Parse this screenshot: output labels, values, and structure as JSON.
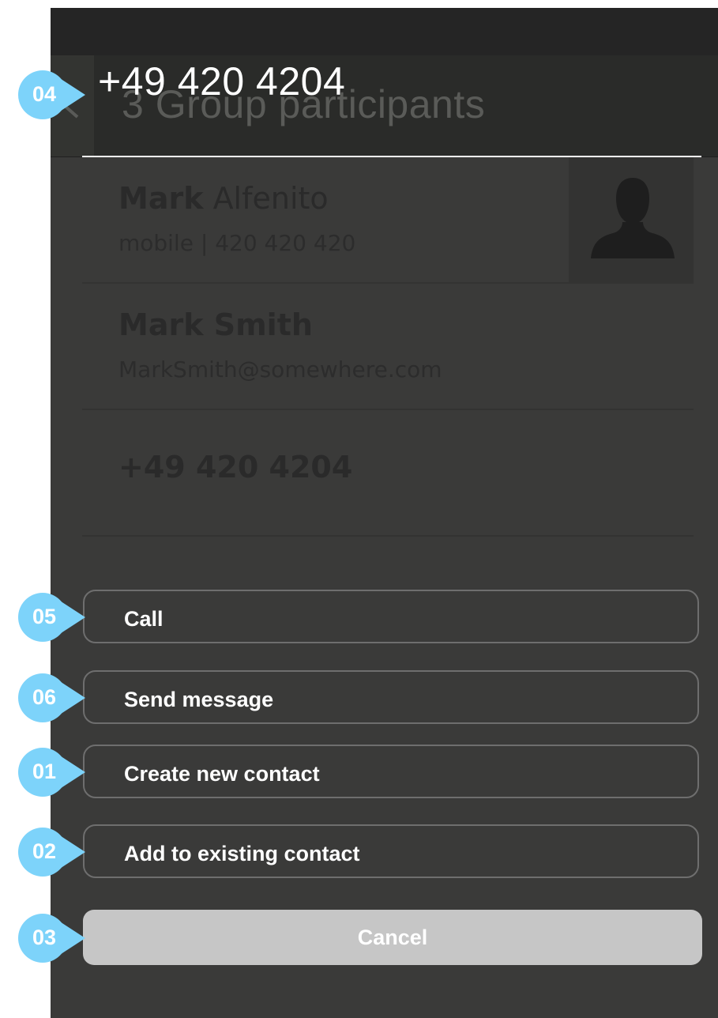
{
  "header": {
    "background_title": "3 Group participants",
    "title": "+49 420 4204"
  },
  "contacts": [
    {
      "first_name": "Mark",
      "last_name": "Alfenito",
      "detail": "mobile  |  420 420 420"
    },
    {
      "name": "Mark Smith",
      "detail": "MarkSmith@somewhere.com"
    },
    {
      "name": "+49 420 4204"
    }
  ],
  "actions": {
    "call": "Call",
    "send_message": "Send message",
    "create_contact": "Create new contact",
    "add_existing": "Add to existing contact",
    "cancel": "Cancel"
  },
  "markers": {
    "m04": "04",
    "m05": "05",
    "m06": "06",
    "m01": "01",
    "m02": "02",
    "m03": "03"
  },
  "colors": {
    "marker": "#7dd3fa",
    "background": "#3a3a39",
    "cancel_button": "#c6c6c6"
  }
}
